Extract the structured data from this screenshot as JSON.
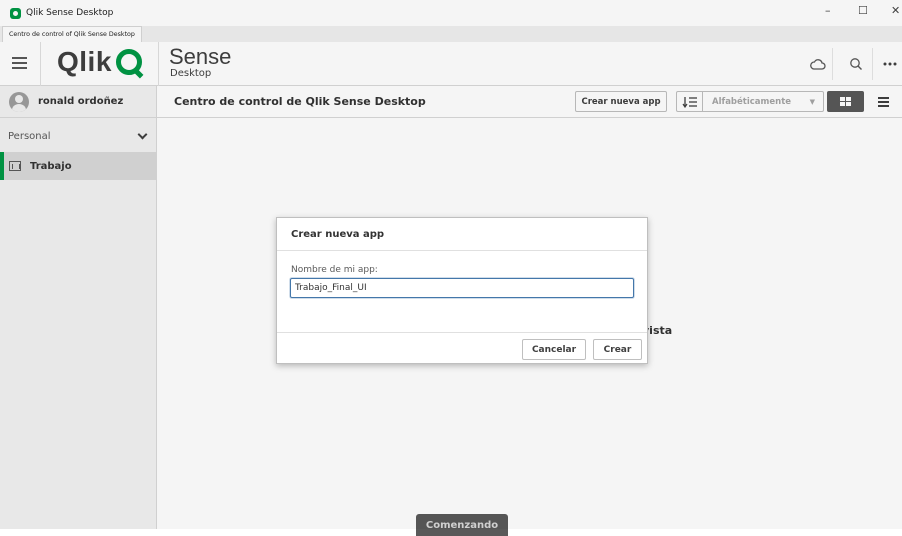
{
  "window": {
    "title": "Qlik Sense Desktop",
    "controls": {
      "minimize": "–",
      "maximize": "☐",
      "close": "✕"
    }
  },
  "tab": {
    "label": "Centro de control of Qlik Sense Desktop"
  },
  "header": {
    "logo_text": "Qlik",
    "product": "Sense",
    "edition": "Desktop",
    "icons": [
      "cloud-icon",
      "search-icon",
      "more-icon"
    ],
    "brand_color": "#009845"
  },
  "sidebar": {
    "user_name": "ronald ordoñez",
    "section_label": "Personal",
    "items": [
      {
        "label": "Trabajo",
        "icon": "stream-icon",
        "selected": true
      }
    ]
  },
  "toolbar": {
    "title": "Centro de control de Qlik Sense Desktop",
    "create_button": "Crear nueva app",
    "sort_label": "Alfabéticamente",
    "sort_caret": "▼"
  },
  "main": {
    "background_text": "vista",
    "getting_started": "Comenzando"
  },
  "dialog": {
    "title": "Crear nueva app",
    "field_label": "Nombre de mi app:",
    "field_value": "Trabajo_Final_UI",
    "cancel_button": "Cancelar",
    "create_button": "Crear"
  }
}
